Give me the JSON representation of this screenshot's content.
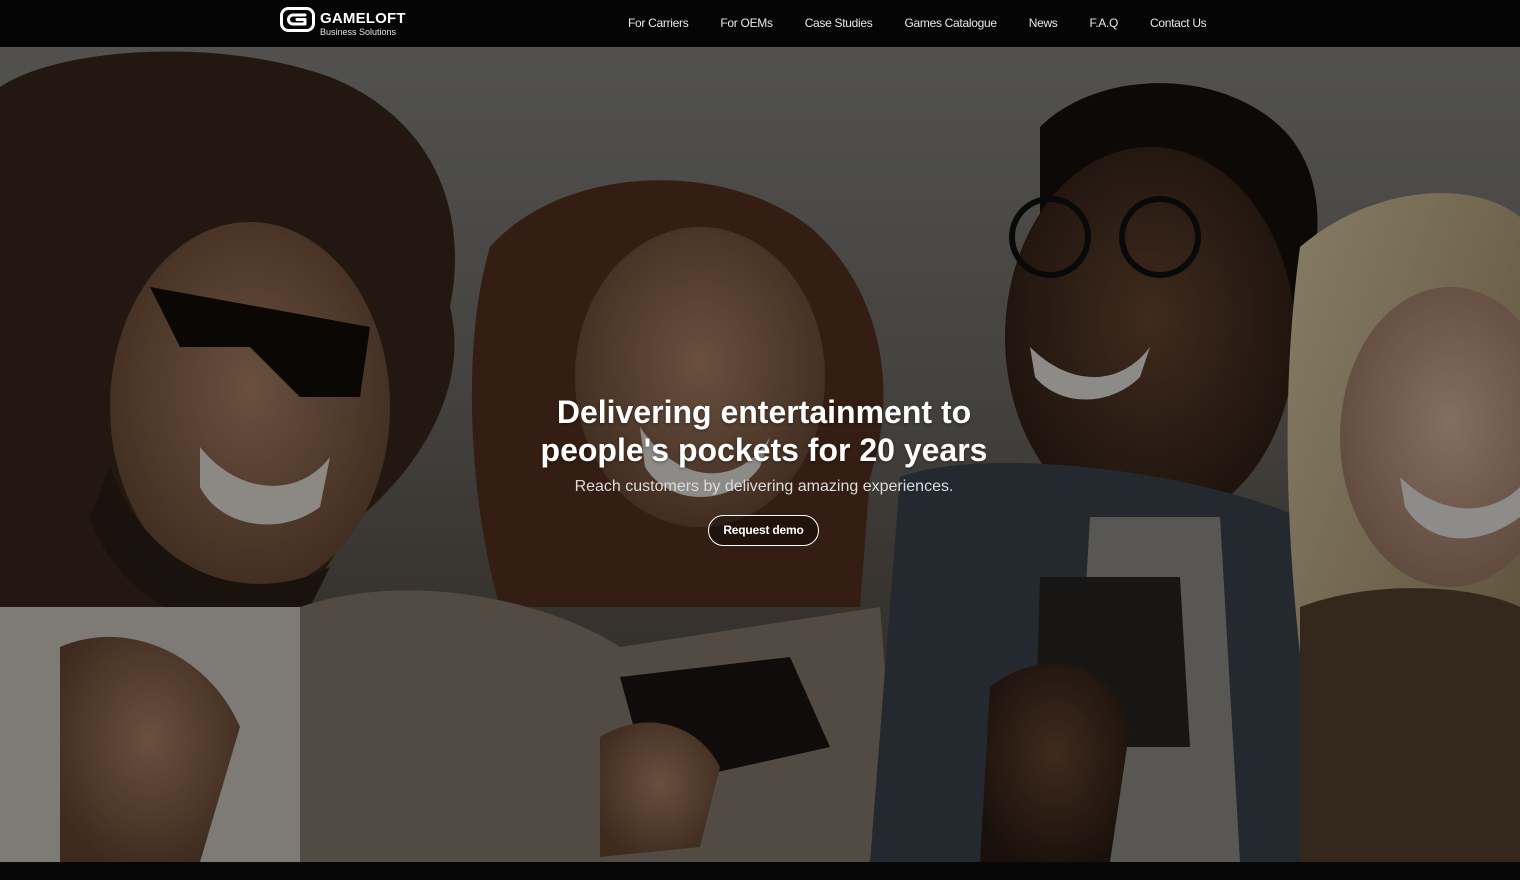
{
  "brand": {
    "name": "GAMELOFT",
    "tagline": "Business Solutions"
  },
  "nav": {
    "items": [
      {
        "label": "For Carriers"
      },
      {
        "label": "For OEMs"
      },
      {
        "label": "Case Studies"
      },
      {
        "label": "Games Catalogue"
      },
      {
        "label": "News"
      },
      {
        "label": "F.A.Q"
      },
      {
        "label": "Contact Us"
      }
    ]
  },
  "hero": {
    "title_line1": "Delivering entertainment to",
    "title_line2": "people's pockets for 20 years",
    "subtitle": "Reach customers by delivering amazing experiences.",
    "cta_label": "Request demo",
    "image_subject": "four-friends-laughing-with-smartphones-photo"
  },
  "colors": {
    "nav_background": "#050505",
    "text_primary": "#ffffff",
    "overlay": "rgba(0,0,0,0.42)"
  }
}
